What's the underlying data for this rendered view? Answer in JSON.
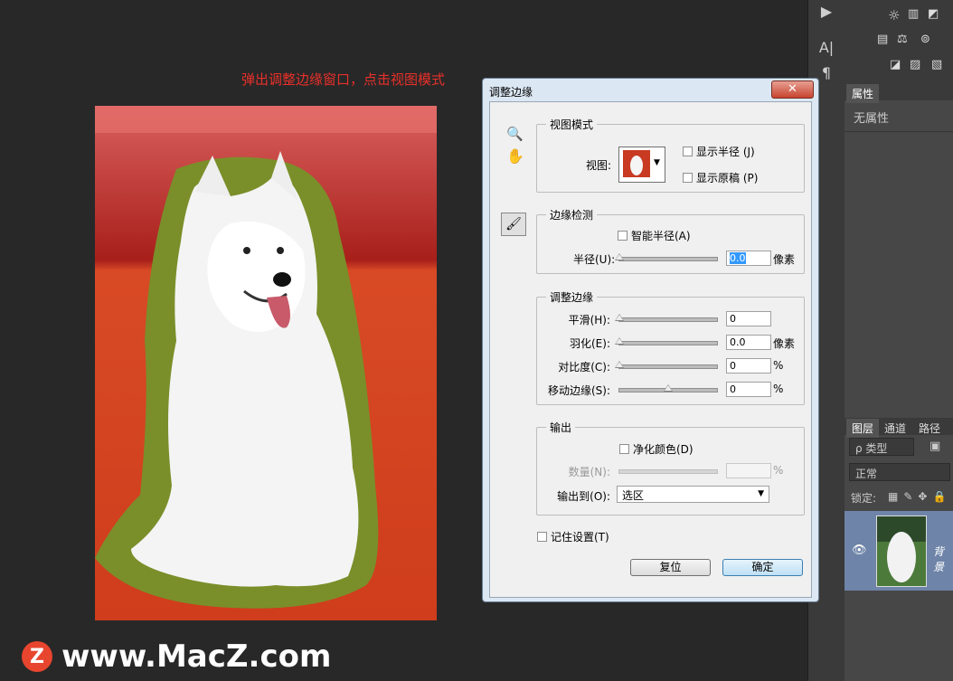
{
  "annotation": "弹出调整边缘窗口，点击视图模式",
  "watermark": {
    "logo_letter": "Z",
    "text": "www.MacZ.com"
  },
  "toolstrip": {
    "play_icon": "play-icon",
    "text_tool": "A|",
    "paragraph": "¶"
  },
  "properties_panel": {
    "tab": "属性",
    "empty_text": "无属性"
  },
  "layers_panel": {
    "tabs": [
      "图层",
      "通道",
      "路径"
    ],
    "filter_label": "ρ 类型",
    "blend_mode": "正常",
    "lock_label": "锁定:",
    "layer_name": "背景"
  },
  "dialog": {
    "title": "调整边缘",
    "close_label": "✕",
    "view_mode": {
      "group_title": "视图模式",
      "view_label": "视图:",
      "show_radius": "显示半径 (J)",
      "show_original": "显示原稿 (P)"
    },
    "edge_detection": {
      "group_title": "边缘检测",
      "smart_radius": "智能半径(A)",
      "radius_label": "半径(U):",
      "radius_value": "0.0",
      "radius_unit": "像素"
    },
    "adjust_edge": {
      "group_title": "调整边缘",
      "smooth_label": "平滑(H):",
      "smooth_value": "0",
      "feather_label": "羽化(E):",
      "feather_value": "0.0",
      "feather_unit": "像素",
      "contrast_label": "对比度(C):",
      "contrast_value": "0",
      "contrast_unit": "%",
      "shift_label": "移动边缘(S):",
      "shift_value": "0",
      "shift_unit": "%"
    },
    "output": {
      "group_title": "输出",
      "decontaminate": "净化颜色(D)",
      "amount_label": "数量(N):",
      "amount_unit": "%",
      "output_to_label": "输出到(O):",
      "output_to_value": "选区"
    },
    "remember": "记住设置(T)",
    "reset_button": "复位",
    "ok_button": "确定"
  }
}
